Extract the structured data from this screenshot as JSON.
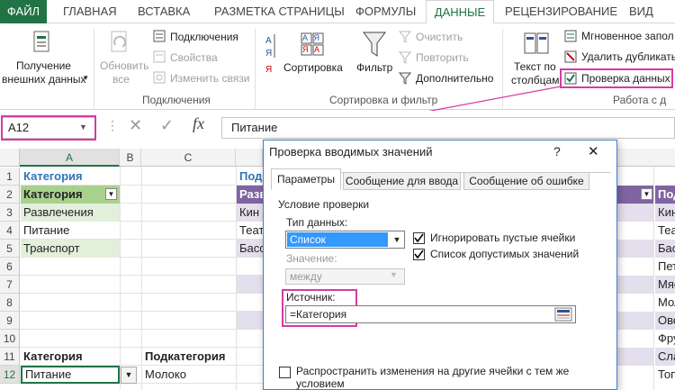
{
  "ribbon": {
    "tabs": [
      "ФАЙЛ",
      "ГЛАВНАЯ",
      "ВСТАВКА",
      "РАЗМЕТКА СТРАНИЦЫ",
      "ФОРМУЛЫ",
      "ДАННЫЕ",
      "РЕЦЕНЗИРОВАНИЕ",
      "ВИД"
    ],
    "get_external_line1": "Получение",
    "get_external_line2": "внешних данных",
    "refresh_line1": "Обновить",
    "refresh_line2": "все",
    "connections": "Подключения",
    "properties": "Свойства",
    "edit_links": "Изменить связи",
    "group_connections": "Подключения",
    "sort": "Сортировка",
    "filter": "Фильтр",
    "clear": "Очистить",
    "reapply": "Повторить",
    "advanced": "Дополнительно",
    "group_sort_filter": "Сортировка и фильтр",
    "text_to_cols_line1": "Текст по",
    "text_to_cols_line2": "столбцам",
    "flash_fill": "Мгновенное запол",
    "remove_dupes": "Удалить дубликать",
    "data_validation": "Проверка данных",
    "group_data_tools": "Работа с д",
    "sort_az_top": "А Я",
    "sort_za_top": "Я А"
  },
  "formula_bar": {
    "name_box": "A12",
    "cancel": "✕",
    "confirm": "✓",
    "fx": "fx",
    "formula": "Питание"
  },
  "sheet": {
    "columns": [
      "A",
      "B",
      "C"
    ],
    "rows": [
      "1",
      "2",
      "3",
      "4",
      "5",
      "6",
      "7",
      "8",
      "9",
      "10",
      "11",
      "12"
    ],
    "a1": "Категория",
    "a2": "Категория",
    "a3": "Развлечения",
    "a4": "Питание",
    "a5": "Транспорт",
    "a11": "Категория",
    "c11": "Подкатегория",
    "a12": "Питание",
    "c12": "Молоко",
    "partial_col_title": "Подк",
    "partial_hdr": "Разв",
    "partial_rows": [
      "Кин",
      "Теат",
      "Басс"
    ],
    "right_col_hdr": "Под",
    "right_col_vals": [
      "Кин",
      "Теа",
      "Бас",
      "Пет",
      "Мяс",
      "Мол",
      "Ово",
      "Фру",
      "Сла",
      "Топ"
    ]
  },
  "dialog": {
    "title": "Проверка вводимых значений",
    "help": "?",
    "close": "✕",
    "tabs": [
      "Параметры",
      "Сообщение для ввода",
      "Сообщение об ошибке"
    ],
    "group_title": "Условие проверки",
    "data_type_label": "Тип данных:",
    "data_type_value": "Список",
    "value_label": "Значение:",
    "value_value": "между",
    "ignore_blank": "Игнорировать пустые ячейки",
    "dropdown_list": "Список допустимых значений",
    "source_label": "Источник:",
    "source_value": "=Категория",
    "apply_all_line1": "Распространить изменения на другие ячейки с тем же",
    "apply_all_line2": "условием"
  },
  "colors": {
    "excel_green": "#217346",
    "highlight_magenta": "#d63aa6",
    "table_header_green": "#a9d18e",
    "table_header_purple": "#8064a2",
    "table_row_green": "#e2efda",
    "table_row_purple": "#e4dfec"
  }
}
